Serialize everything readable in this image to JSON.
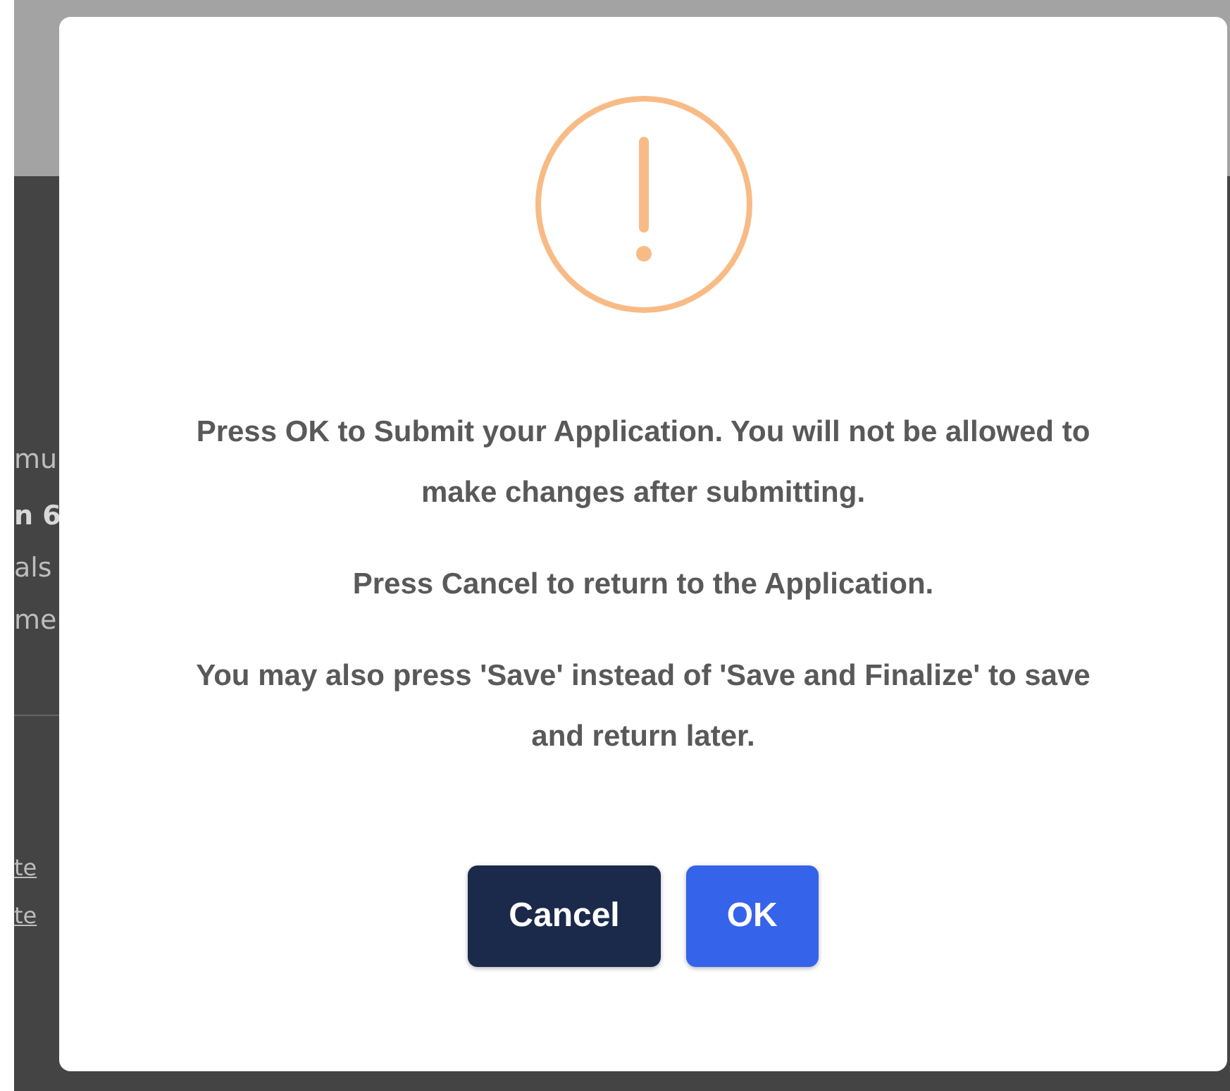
{
  "background": {
    "texts": [
      {
        "text": "mu",
        "kind": "plain"
      },
      {
        "text": "n 6",
        "kind": "bold"
      },
      {
        "text": "als",
        "kind": "plain"
      },
      {
        "text": "me",
        "kind": "plain"
      },
      {
        "text": "te",
        "kind": "link"
      },
      {
        "text": "te",
        "kind": "link"
      }
    ]
  },
  "dialog": {
    "messages": [
      "Press OK to Submit your Application. You will not be allowed to make changes after submitting.",
      "Press Cancel to return to the Application.",
      "You may also press 'Save' instead of 'Save and Finalize' to save and return later."
    ],
    "buttons": [
      {
        "label": "Cancel",
        "kind": "secondary"
      },
      {
        "label": "OK",
        "kind": "primary"
      }
    ]
  }
}
